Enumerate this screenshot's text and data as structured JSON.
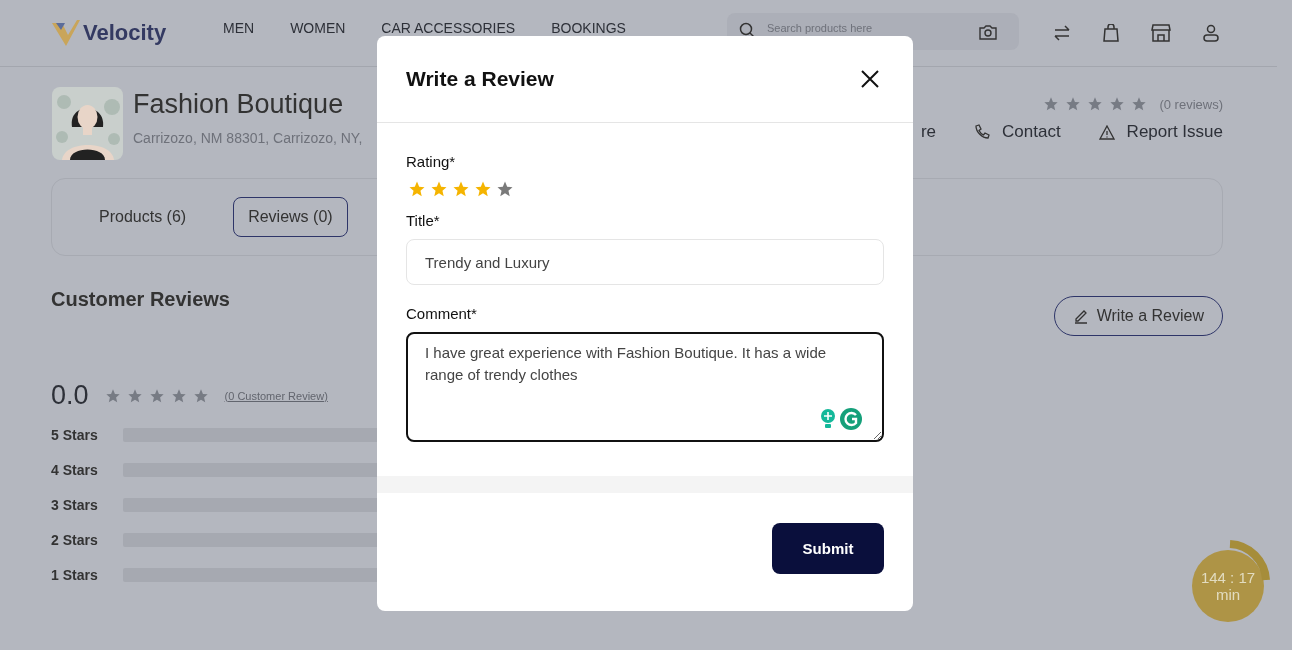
{
  "header": {
    "logo": "Velocity",
    "nav": [
      {
        "label": "MEN"
      },
      {
        "label": "WOMEN"
      },
      {
        "label": "CAR ACCESSORIES"
      },
      {
        "label": "BOOKINGS"
      }
    ],
    "search": {
      "placeholder": "Search products here"
    }
  },
  "store": {
    "name": "Fashion Boutique",
    "address": "Carrizozo, NM 88301, Carrizozo, NY,",
    "stars": 0,
    "reviews": "(0 reviews)",
    "actions": [
      {
        "kind": "cut",
        "label": "re"
      },
      {
        "kind": "phone",
        "label": "Contact"
      },
      {
        "kind": "warning",
        "label": "Report Issue"
      }
    ]
  },
  "tabs": [
    {
      "label": "Products (6)",
      "selected": false
    },
    {
      "label": "Reviews (0)",
      "selected": true
    }
  ],
  "reviews": {
    "heading": "Customer Reviews",
    "write_button": "Write a Review",
    "average": "0.0",
    "stars": 0,
    "count_link": "(0 Customer Review)",
    "breakdown": [
      {
        "label": "5 Stars",
        "level": 0
      },
      {
        "label": "4 Stars",
        "level": 0
      },
      {
        "label": "3 Stars",
        "level": 0
      },
      {
        "label": "2 Stars",
        "level": 0
      },
      {
        "label": "1 Stars",
        "level": 0
      }
    ]
  },
  "timer": {
    "time": "144 : 17",
    "unit": "min"
  },
  "modal": {
    "title": "Write a Review",
    "rating_label": "Rating*",
    "rating": {
      "stars": 4
    },
    "title_label": "Title*",
    "title_value": "Trendy and Luxury",
    "comment_label": "Comment*",
    "comment_value": "I have great experience with Fashion Boutique. It has a wide range of trendy clothes",
    "submit": "Submit"
  }
}
